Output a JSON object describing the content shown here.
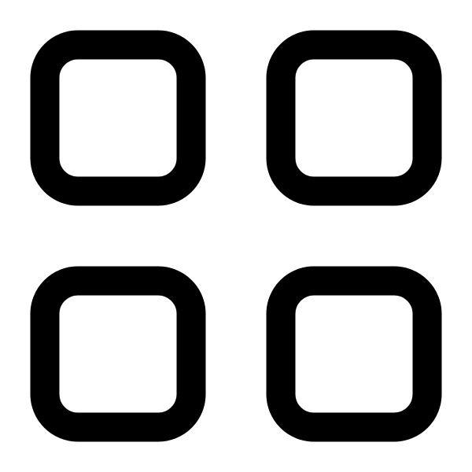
{
  "icon": {
    "name": "grid-icon",
    "tiles": [
      "top-left",
      "top-right",
      "bottom-left",
      "bottom-right"
    ],
    "stroke_color": "#000000",
    "background_color": "#ffffff"
  }
}
